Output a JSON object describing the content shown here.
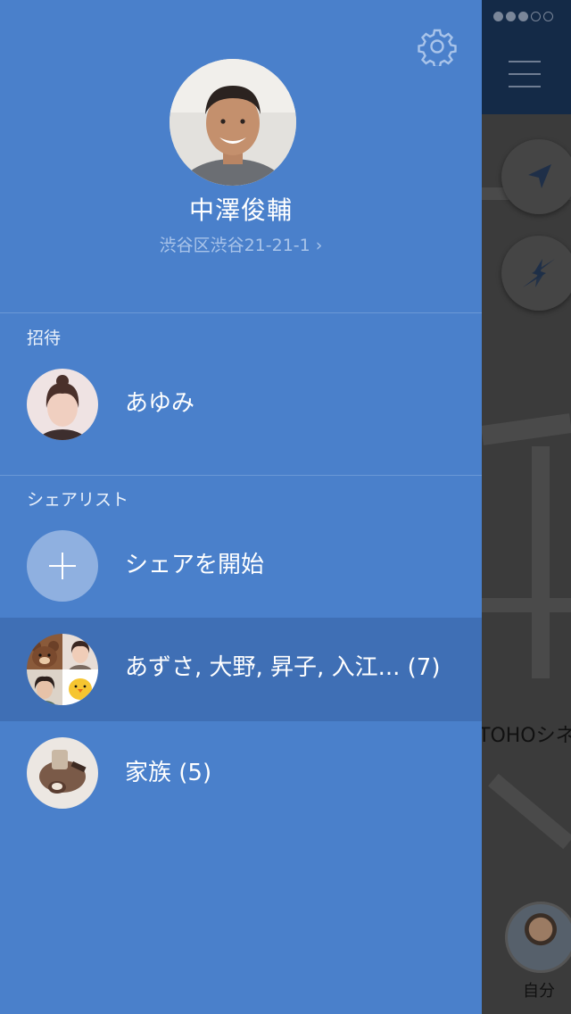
{
  "status": {
    "signal_icon": "signal-dots-icon"
  },
  "map": {
    "place_label": "TOHOシネ",
    "self_label": "自分",
    "menu_icon": "hamburger-icon",
    "locate_icon": "location-arrow-icon",
    "share_icon": "share-arrows-icon"
  },
  "drawer": {
    "settings_icon": "gear-icon",
    "profile": {
      "name": "中澤俊輔",
      "address": "渋谷区渋谷21-21-1",
      "address_chevron": "›"
    },
    "invite": {
      "section_label": "招待",
      "items": [
        {
          "name": "あゆみ"
        }
      ]
    },
    "share_list": {
      "section_label": "シェアリスト",
      "start_label": "シェアを開始",
      "items": [
        {
          "name": "あずさ, 大野, 昇子, 入江... (7)"
        },
        {
          "name": "家族 (5)"
        }
      ]
    }
  },
  "colors": {
    "drawer_bg": "#4a80cb",
    "selected_row": "#3f6fb5",
    "address_text": "#a9c4ea"
  }
}
